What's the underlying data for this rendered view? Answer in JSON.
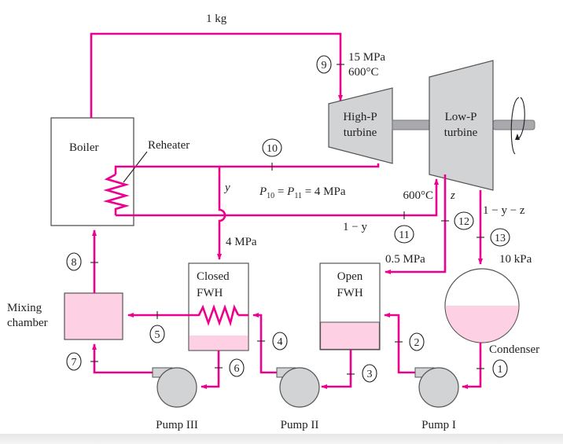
{
  "colors": {
    "pipe": "#ec008c",
    "liquid": "#fdd0e4",
    "equipment": "#d1d3d4"
  },
  "labels": {
    "mass": "1 kg",
    "state9_p": "15 MPa",
    "state9_t": "600°C",
    "hp_turbine_1": "High-P",
    "hp_turbine_2": "turbine",
    "lp_turbine_1": "Low-P",
    "lp_turbine_2": "turbine",
    "boiler": "Boiler",
    "reheater": "Reheater",
    "y": "y",
    "p_eq": {
      "p1": "P",
      "s1": "10",
      "eq1": " = ",
      "p2": "P",
      "s2": "11",
      "eq2": " = 4 MPa"
    },
    "reheat_t": "600°C",
    "z": "z",
    "one_minus_y": "1 − y",
    "one_minus_y_z": "1 − y  − z",
    "closed_p": "4 MPa",
    "open_p": "0.5 MPa",
    "cond_p": "10 kPa",
    "closed_fwh_1": "Closed",
    "closed_fwh_2": "FWH",
    "open_fwh_1": "Open",
    "open_fwh_2": "FWH",
    "mixing_1": "Mixing",
    "mixing_2": "chamber",
    "condenser": "Condenser",
    "pump3": "Pump III",
    "pump2": "Pump II",
    "pump1": "Pump I"
  },
  "states": [
    "1",
    "2",
    "3",
    "4",
    "5",
    "6",
    "7",
    "8",
    "9",
    "10",
    "11",
    "12",
    "13"
  ]
}
